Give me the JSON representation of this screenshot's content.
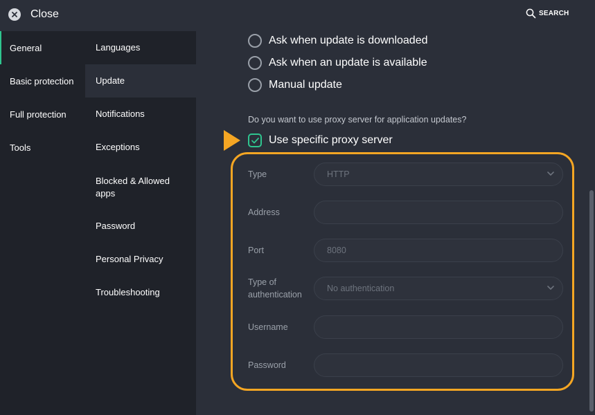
{
  "header": {
    "close_label": "Close",
    "search_label": "SEARCH"
  },
  "sidebar": {
    "items": [
      {
        "label": "General",
        "active": true
      },
      {
        "label": "Basic protection",
        "active": false
      },
      {
        "label": "Full protection",
        "active": false
      },
      {
        "label": "Tools",
        "active": false
      }
    ]
  },
  "subnav": {
    "items": [
      {
        "label": "Languages"
      },
      {
        "label": "Update",
        "selected": true
      },
      {
        "label": "Notifications"
      },
      {
        "label": "Exceptions"
      },
      {
        "label": "Blocked & Allowed apps"
      },
      {
        "label": "Password"
      },
      {
        "label": "Personal Privacy"
      },
      {
        "label": "Troubleshooting"
      }
    ]
  },
  "main": {
    "radios": [
      {
        "label": "Ask when update is downloaded"
      },
      {
        "label": "Ask when an update is available"
      },
      {
        "label": "Manual update"
      }
    ],
    "proxy_question": "Do you want to use proxy server for application updates?",
    "proxy_checkbox": {
      "label": "Use specific proxy server",
      "checked": true
    },
    "form": {
      "type_label": "Type",
      "type_value": "HTTP",
      "address_label": "Address",
      "address_value": "",
      "port_label": "Port",
      "port_placeholder": "8080",
      "auth_label": "Type of authentication",
      "auth_value": "No authentication",
      "username_label": "Username",
      "username_value": "",
      "password_label": "Password",
      "password_value": ""
    }
  },
  "colors": {
    "accent_green": "#2fc58f",
    "highlight_orange": "#f5a623",
    "background": "#2b2f39",
    "sidebar_bg": "#1f2229"
  }
}
